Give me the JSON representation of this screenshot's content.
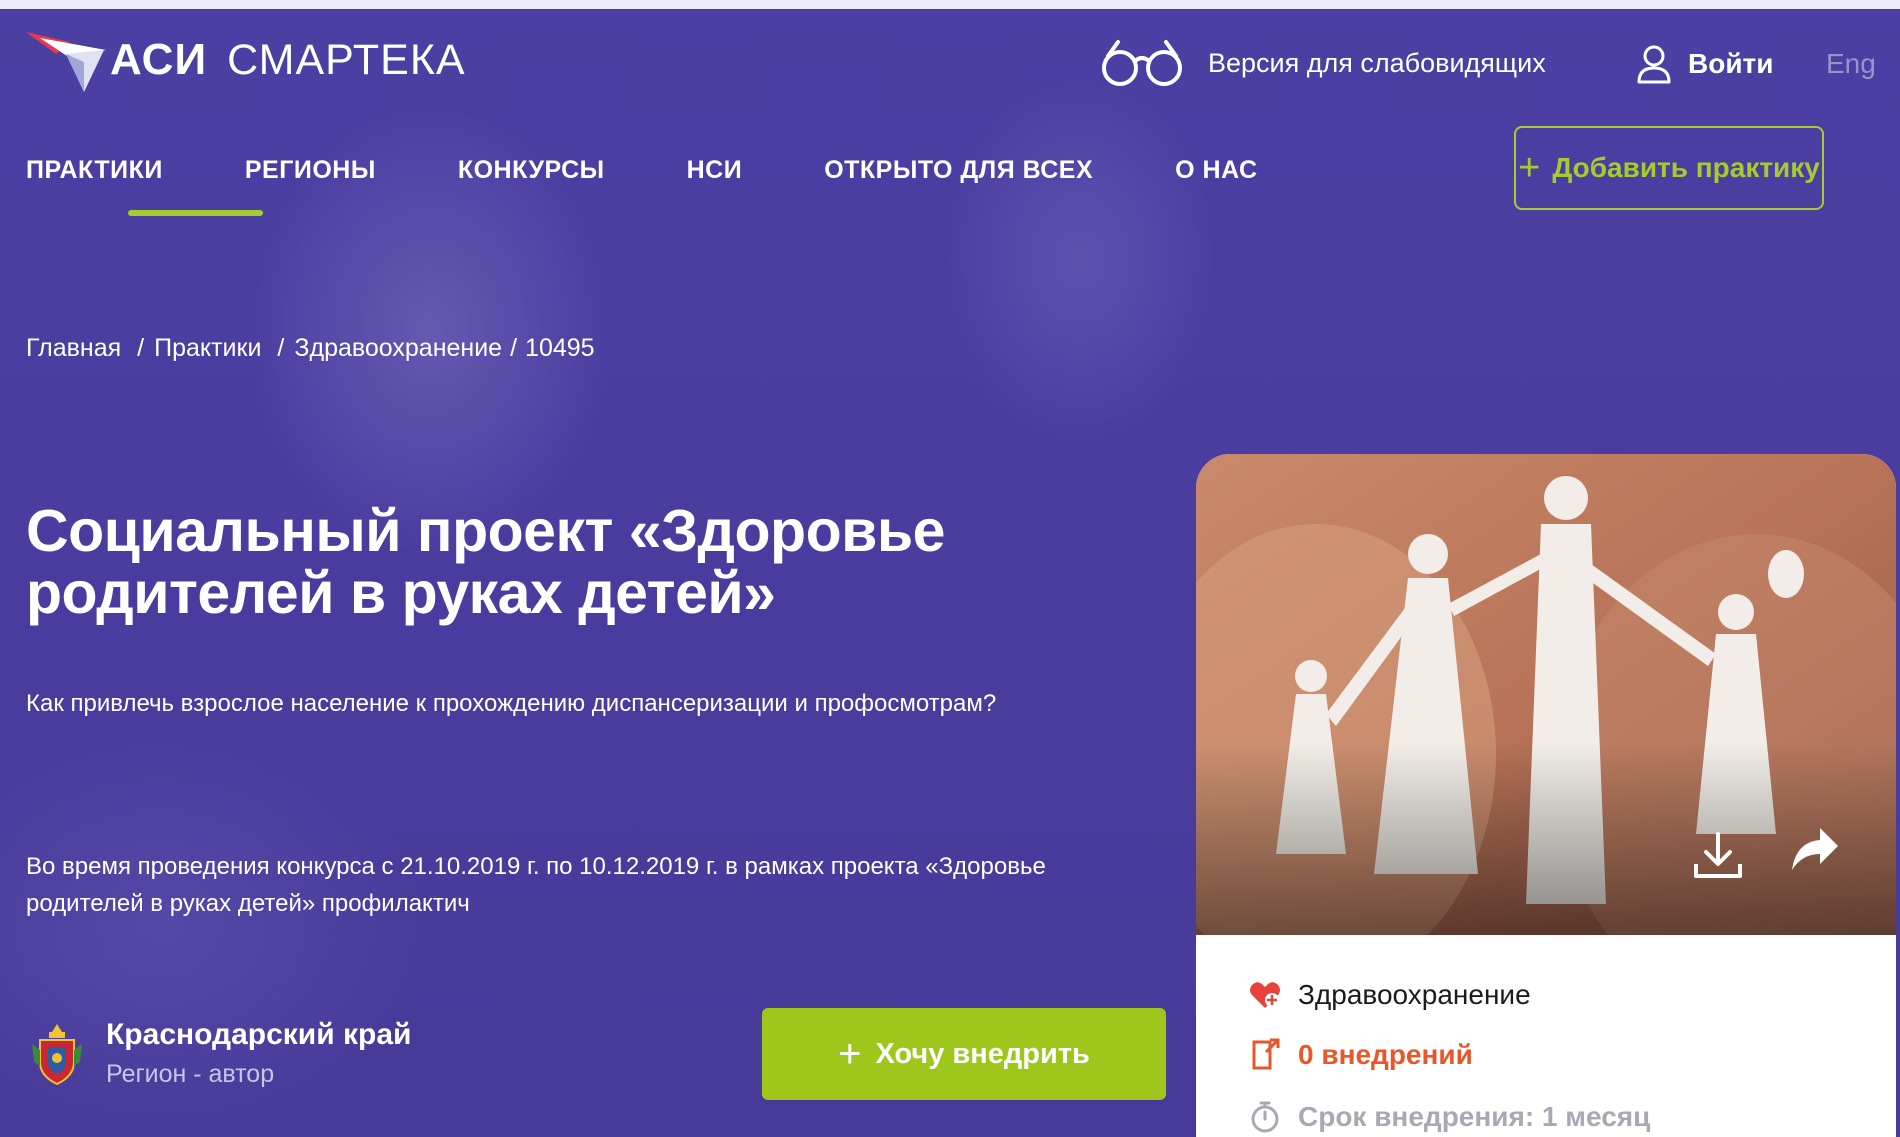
{
  "header": {
    "logo_bold": "АСИ",
    "logo_light": "СМАРТЕКА",
    "accessibility_label": "Версия для слабовидящих",
    "login_label": "Войти",
    "lang_label": "Eng"
  },
  "nav": {
    "items": [
      {
        "label": "ПРАКТИКИ"
      },
      {
        "label": "РЕГИОНЫ"
      },
      {
        "label": "КОНКУРСЫ"
      },
      {
        "label": "НСИ"
      },
      {
        "label": "ОТКРЫТО ДЛЯ ВСЕХ"
      },
      {
        "label": "О НАС"
      }
    ],
    "add_practice_label": "Добавить практику"
  },
  "breadcrumb": {
    "home": "Главная",
    "practices": "Практики",
    "category": "Здравоохранение",
    "id": "10495"
  },
  "main": {
    "title": "Социальный проект «Здоровье родителей в руках детей»",
    "subtitle": "Как привлечь взрослое население к прохождению диспансеризации и профосмотрам?",
    "description": "Во время проведения конкурса с 21.10.2019 г. по 10.12.2019 г. в рамках проекта «Здоровье родителей в руках детей» профилактич",
    "region_name": "Краснодарский край",
    "region_role": "Регион - автор",
    "want_button_label": "Хочу внедрить"
  },
  "card": {
    "category": "Здравоохранение",
    "implementations": "0 внедрений",
    "term": "Срок внедрения: 1 месяц"
  },
  "icons": {
    "accessibility": "glasses-icon",
    "login": "user-icon",
    "add": "plus-icon",
    "category": "heart-icon",
    "implementations": "document-icon",
    "term": "stopwatch-icon",
    "download": "download-icon",
    "share": "share-icon"
  },
  "colors": {
    "background": "#4a3c9e",
    "accent_green": "#a3cc2f",
    "button_green": "#9fc61b",
    "implementations_orange": "#e8572a",
    "muted_text": "#a9a9b3"
  }
}
